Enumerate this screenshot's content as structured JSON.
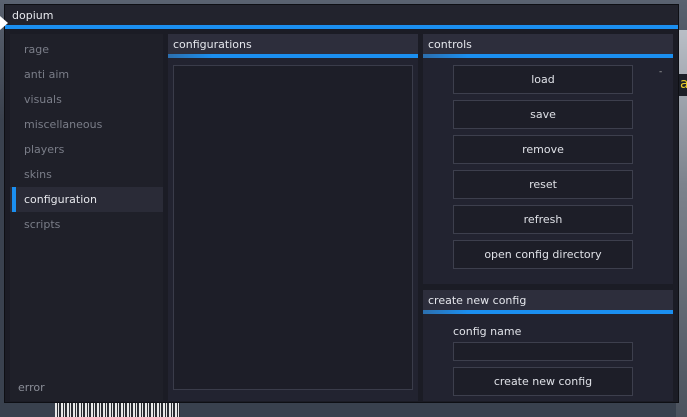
{
  "window": {
    "title": "dopium"
  },
  "sidebar": {
    "items": [
      {
        "label": "rage",
        "active": false
      },
      {
        "label": "anti aim",
        "active": false
      },
      {
        "label": "visuals",
        "active": false
      },
      {
        "label": "miscellaneous",
        "active": false
      },
      {
        "label": "players",
        "active": false
      },
      {
        "label": "skins",
        "active": false
      },
      {
        "label": "configuration",
        "active": true
      },
      {
        "label": "scripts",
        "active": false
      }
    ],
    "status": "error"
  },
  "configurations": {
    "title": "configurations",
    "items": []
  },
  "controls": {
    "title": "controls",
    "indicator": "-",
    "buttons": {
      "load": "load",
      "save": "save",
      "remove": "remove",
      "reset": "reset",
      "refresh": "refresh",
      "open_dir": "open config directory"
    }
  },
  "create": {
    "title": "create new config",
    "name_label": "config name",
    "name_value": "",
    "button": "create new config"
  },
  "colors": {
    "accent": "#1b8ff0",
    "window_bg": "#1b1c25",
    "panel_bg": "#222330"
  }
}
